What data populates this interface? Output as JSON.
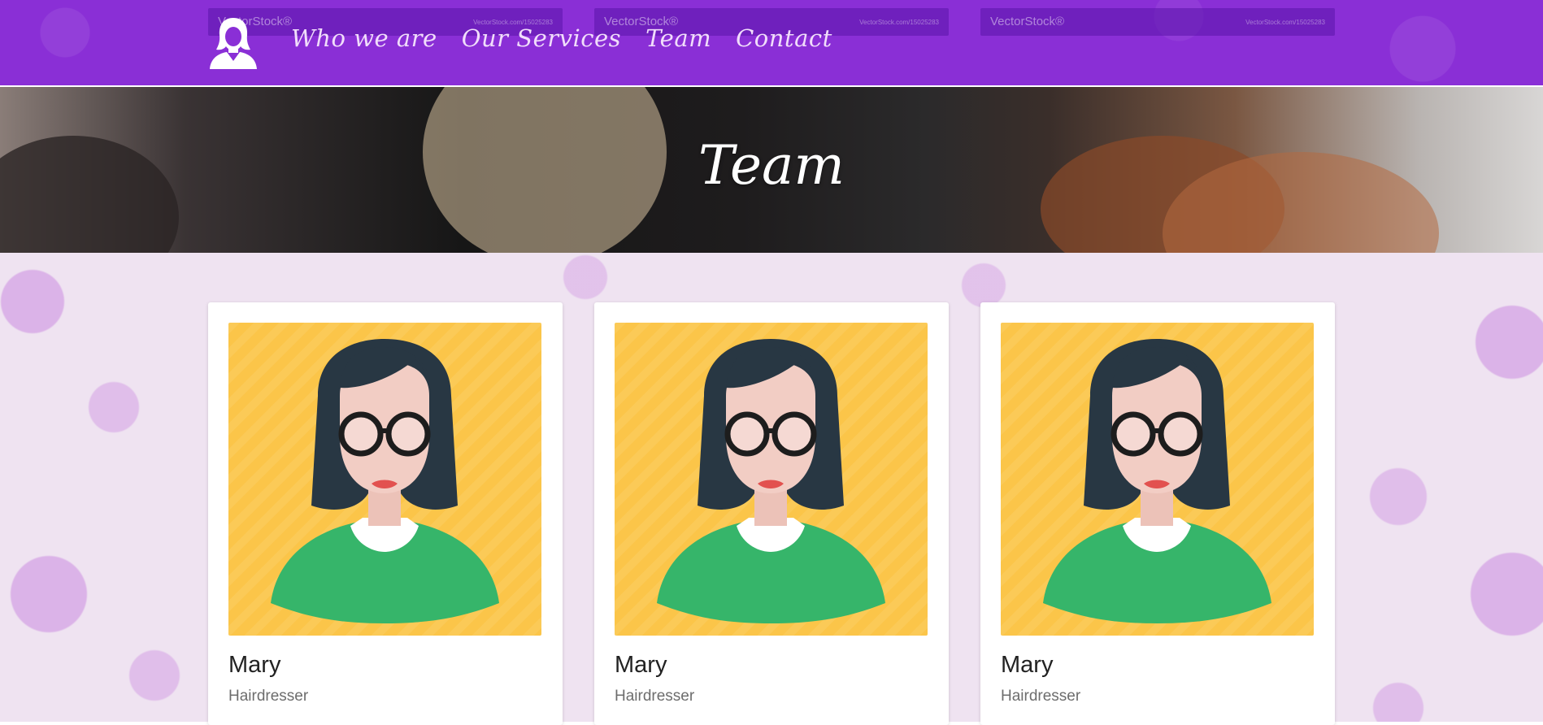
{
  "header": {
    "logo_icon": "woman-silhouette-icon",
    "nav": [
      {
        "label": "Who we are"
      },
      {
        "label": "Our Services"
      },
      {
        "label": "Team"
      },
      {
        "label": "Contact"
      }
    ],
    "watermarks": [
      {
        "brand": "VectorStock®",
        "id": "VectorStock.com/15025283"
      },
      {
        "brand": "VectorStock®",
        "id": "VectorStock.com/15025283"
      },
      {
        "brand": "VectorStock®",
        "id": "VectorStock.com/15025283"
      }
    ],
    "color": "#8a2fd6"
  },
  "hero": {
    "title": "Team"
  },
  "team": [
    {
      "name": "Mary",
      "role": "Hairdresser",
      "avatar_icon": "woman-avatar-icon"
    },
    {
      "name": "Mary",
      "role": "Hairdresser",
      "avatar_icon": "woman-avatar-icon"
    },
    {
      "name": "Mary",
      "role": "Hairdresser",
      "avatar_icon": "woman-avatar-icon"
    }
  ],
  "colors": {
    "accent": "#8a2fd6",
    "avatar_bg": "#fbc549",
    "shirt": "#36b56a"
  }
}
